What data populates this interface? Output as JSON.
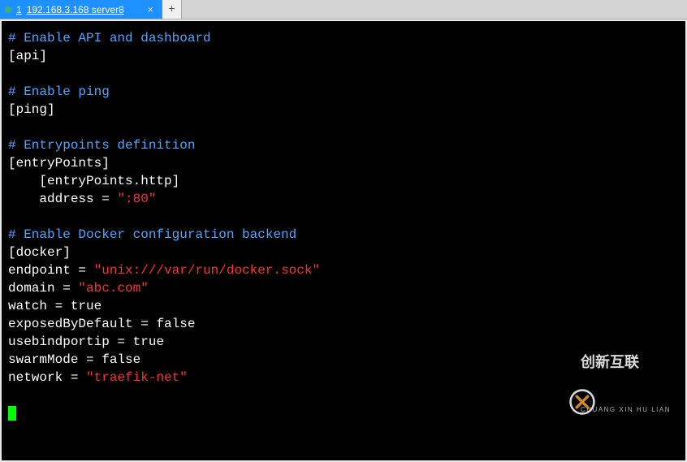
{
  "tab": {
    "index": "1",
    "title": "192.168.3.168 server8",
    "close_glyph": "×",
    "add_glyph": "+"
  },
  "config": {
    "c_api": "# Enable API and dashboard",
    "s_api": "[api]",
    "c_ping": "# Enable ping",
    "s_ping": "[ping]",
    "c_ep": "# Entrypoints definition",
    "s_ep": "[entryPoints]",
    "s_ep_http": "    [entryPoints.http]",
    "k_address": "    address",
    "v_address": "\":80\"",
    "c_docker": "# Enable Docker configuration backend",
    "s_docker": "[docker]",
    "k_endpoint": "endpoint",
    "v_endpoint": "\"unix:///var/run/docker.sock\"",
    "k_domain": "domain",
    "v_domain": "\"abc.com\"",
    "k_watch": "watch",
    "v_watch": "true",
    "k_exposed": "exposedByDefault",
    "v_exposed": "false",
    "k_usebind": "usebindportip",
    "v_usebind": "true",
    "k_swarm": "swarmMode",
    "v_swarm": "false",
    "k_network": "network",
    "v_network": "\"traefik-net\"",
    "eq": " = "
  },
  "watermark": {
    "main": "创新互联",
    "sub": "CHUANG XIN HU LIAN"
  }
}
